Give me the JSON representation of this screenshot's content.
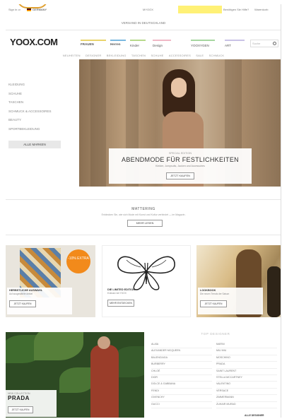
{
  "topbar": {
    "signin": "Sign in or",
    "country": "GERMANY",
    "myoox": "MYOOX",
    "highlight": "",
    "help": "Benötigen Sie Hilfe?",
    "cart": "Warenkorb"
  },
  "promo": "VERSAND IN DEUTSCHLAND",
  "logo": "YOOX.COM",
  "categories": [
    {
      "label": "FRAUEN",
      "color": "#e9d36b"
    },
    {
      "label": "Herren",
      "color": "#7ab8e0"
    },
    {
      "label": "Kinder",
      "color": "#b7d98b"
    },
    {
      "label": "Design",
      "color": "#f0b8c6"
    },
    {
      "label": "YOOXYGEN",
      "color": "#a6d6a0"
    },
    {
      "label": "ART",
      "color": "#c9c2e6"
    }
  ],
  "search": {
    "placeholder": "Suche"
  },
  "subnav": [
    "NEUHEITEN",
    "DESIGNER",
    "BEKLEIDUNG",
    "TASCHEN",
    "SCHUHE",
    "ACCESSOIRES",
    "SALE",
    "SCHMUCK"
  ],
  "sidebar": {
    "items": [
      "KLEIDUNG",
      "SCHUHE",
      "TASCHEN",
      "SCHMUCK & ACCESSOIRES",
      "BEAUTY",
      "SPORTBEKLEIDUNG"
    ],
    "sale_label": "ALLE MARKEN"
  },
  "hero": {
    "pre": "SPECIAL EDITION",
    "title": "ABENDMODE FÜR FESTLICHKEITEN",
    "subtitle": "Kleider, Jumpsuits, Jacken und Accessoires",
    "button": "JETZT KAUFEN"
  },
  "mattering": {
    "title": "MATTERING",
    "text": "Entdecken Sie, wie sich Mode mit Kunst und Kultur verbindet — im Magazin.",
    "button": "MEHR LESEN"
  },
  "tiles": [
    {
      "badge": "-10% EXTRA",
      "title": "HERBSTLICHE AUSWAHL",
      "text": "Auf ausgewählte Artikel",
      "button": "JETZT KAUFEN"
    },
    {
      "title": "DIE LIMITED EDITION",
      "text": "Exklusiv bei YOOX",
      "button": "MEHR ENTDECKEN"
    },
    {
      "title": "LOOKBOOK",
      "text": "Die neuen Trends der Saison",
      "button": "JETZT KAUFEN"
    }
  ],
  "prada": {
    "pre": "NEW COLLECTION",
    "brand": "PRADA",
    "button": "JETZT KAUFEN"
  },
  "designers": {
    "title": "TOP DESIGNER",
    "col1": [
      "ALAÏA",
      "ALEXANDER MCQUEEN",
      "BALENCIAGA",
      "BURBERRY",
      "CHLOÉ",
      "DIOR",
      "DOLCE & GABBANA",
      "FENDI",
      "GIVENCHY",
      "GUCCI"
    ],
    "col2": [
      "MARNI",
      "MIU MIU",
      "MOSCHINO",
      "PRADA",
      "SAINT LAURENT",
      "STELLA MCCARTNEY",
      "VALENTINO",
      "VERSACE",
      "ZIMMERMANN",
      "ZUHAIR MURAD"
    ],
    "all": "ALLE DESIGNER"
  }
}
